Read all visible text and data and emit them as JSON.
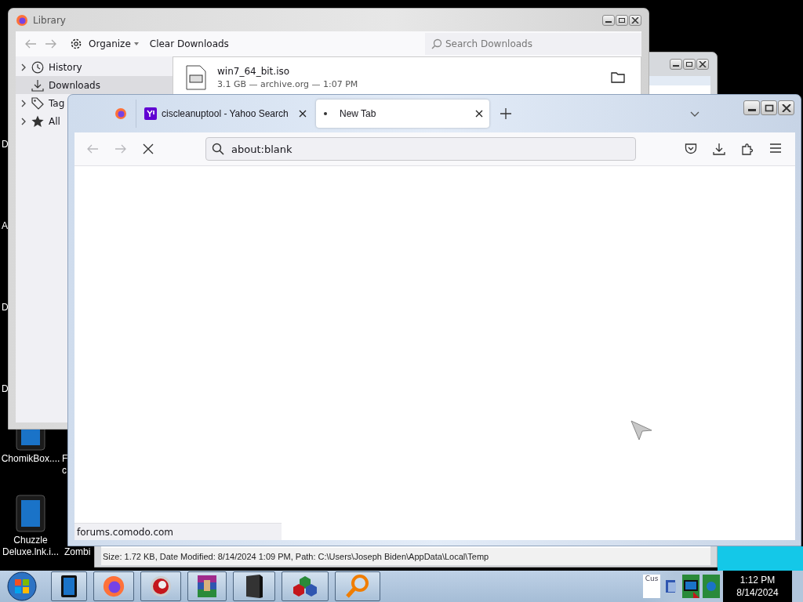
{
  "desktop": {
    "cut_labels": [
      "D",
      "A",
      "D",
      "D",
      "F",
      "c",
      "Zombi"
    ],
    "icons": [
      {
        "label": "ChomikBox...."
      },
      {
        "label": "Chuzzle Deluxe.lnk.i..."
      }
    ]
  },
  "explorer": {
    "status": "Size: 1.72 KB, Date Modified: 8/14/2024 1:09 PM, Path: C:\\Users\\Joseph Biden\\AppData\\Local\\Temp"
  },
  "library": {
    "title": "Library",
    "organize": "Organize",
    "clear": "Clear Downloads",
    "search_placeholder": "Search Downloads",
    "sidebar": [
      {
        "label": "History",
        "expandable": true,
        "selected": false
      },
      {
        "label": "Downloads",
        "expandable": false,
        "selected": true
      },
      {
        "label": "Tag",
        "expandable": true,
        "selected": false
      },
      {
        "label": "All",
        "expandable": true,
        "selected": false
      }
    ],
    "downloads": [
      {
        "name": "win7_64_bit.iso",
        "details": "3.1 GB — archive.org — 1:07 PM"
      }
    ]
  },
  "browser": {
    "tabs": [
      {
        "title": "ciscleanuptool - Yahoo Search",
        "selected": false
      },
      {
        "title": "New Tab",
        "selected": true
      }
    ],
    "back": {
      "disabled": true
    },
    "forward": {
      "disabled": true
    },
    "url": "about:blank",
    "status": "forums.comodo.com"
  },
  "taskbar": {
    "tray_text": "Cus",
    "time": "1:12 PM",
    "date": "8/14/2024"
  }
}
